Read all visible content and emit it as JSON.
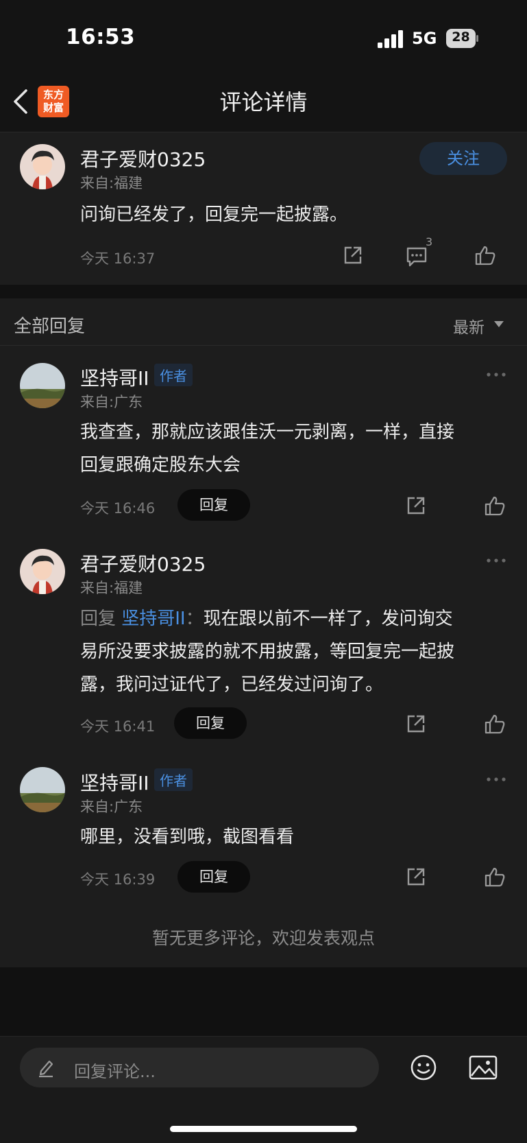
{
  "status": {
    "time": "16:53",
    "network": "5G",
    "battery": "28"
  },
  "header": {
    "title": "评论详情",
    "logo_line1": "东方",
    "logo_line2": "财富"
  },
  "main_comment": {
    "user": "君子爱财0325",
    "location": "来自:福建",
    "text": "问询已经发了，回复完一起披露。",
    "time": "今天 16:37",
    "follow_label": "关注",
    "comment_count": "3"
  },
  "replies_section": {
    "title": "全部回复",
    "sort_label": "最新"
  },
  "replies": [
    {
      "user": "坚持哥II",
      "badge": "作者",
      "location": "来自:广东",
      "text_line1": "我查查，那就应该跟佳沃一元剥离，一样，直接",
      "text_line2": "回复跟确定股东大会",
      "time": "今天 16:46",
      "reply_label": "回复"
    },
    {
      "user": "君子爱财0325",
      "location": "来自:福建",
      "reply_prefix": "回复 ",
      "reply_to": "坚持哥II",
      "reply_colon": "：",
      "text_line1": "现在跟以前不一样了，发问询交",
      "text_line2": "易所没要求披露的就不用披露，等回复完一起披",
      "text_line3": "露，我问过证代了，已经发过问询了。",
      "time": "今天 16:41",
      "reply_label": "回复"
    },
    {
      "user": "坚持哥II",
      "badge": "作者",
      "location": "来自:广东",
      "text_line1": "哪里，没看到哦，截图看看",
      "time": "今天 16:39",
      "reply_label": "回复"
    }
  ],
  "footer": {
    "no_more": "暂无更多评论，欢迎发表观点"
  },
  "input": {
    "placeholder": "回复评论..."
  }
}
